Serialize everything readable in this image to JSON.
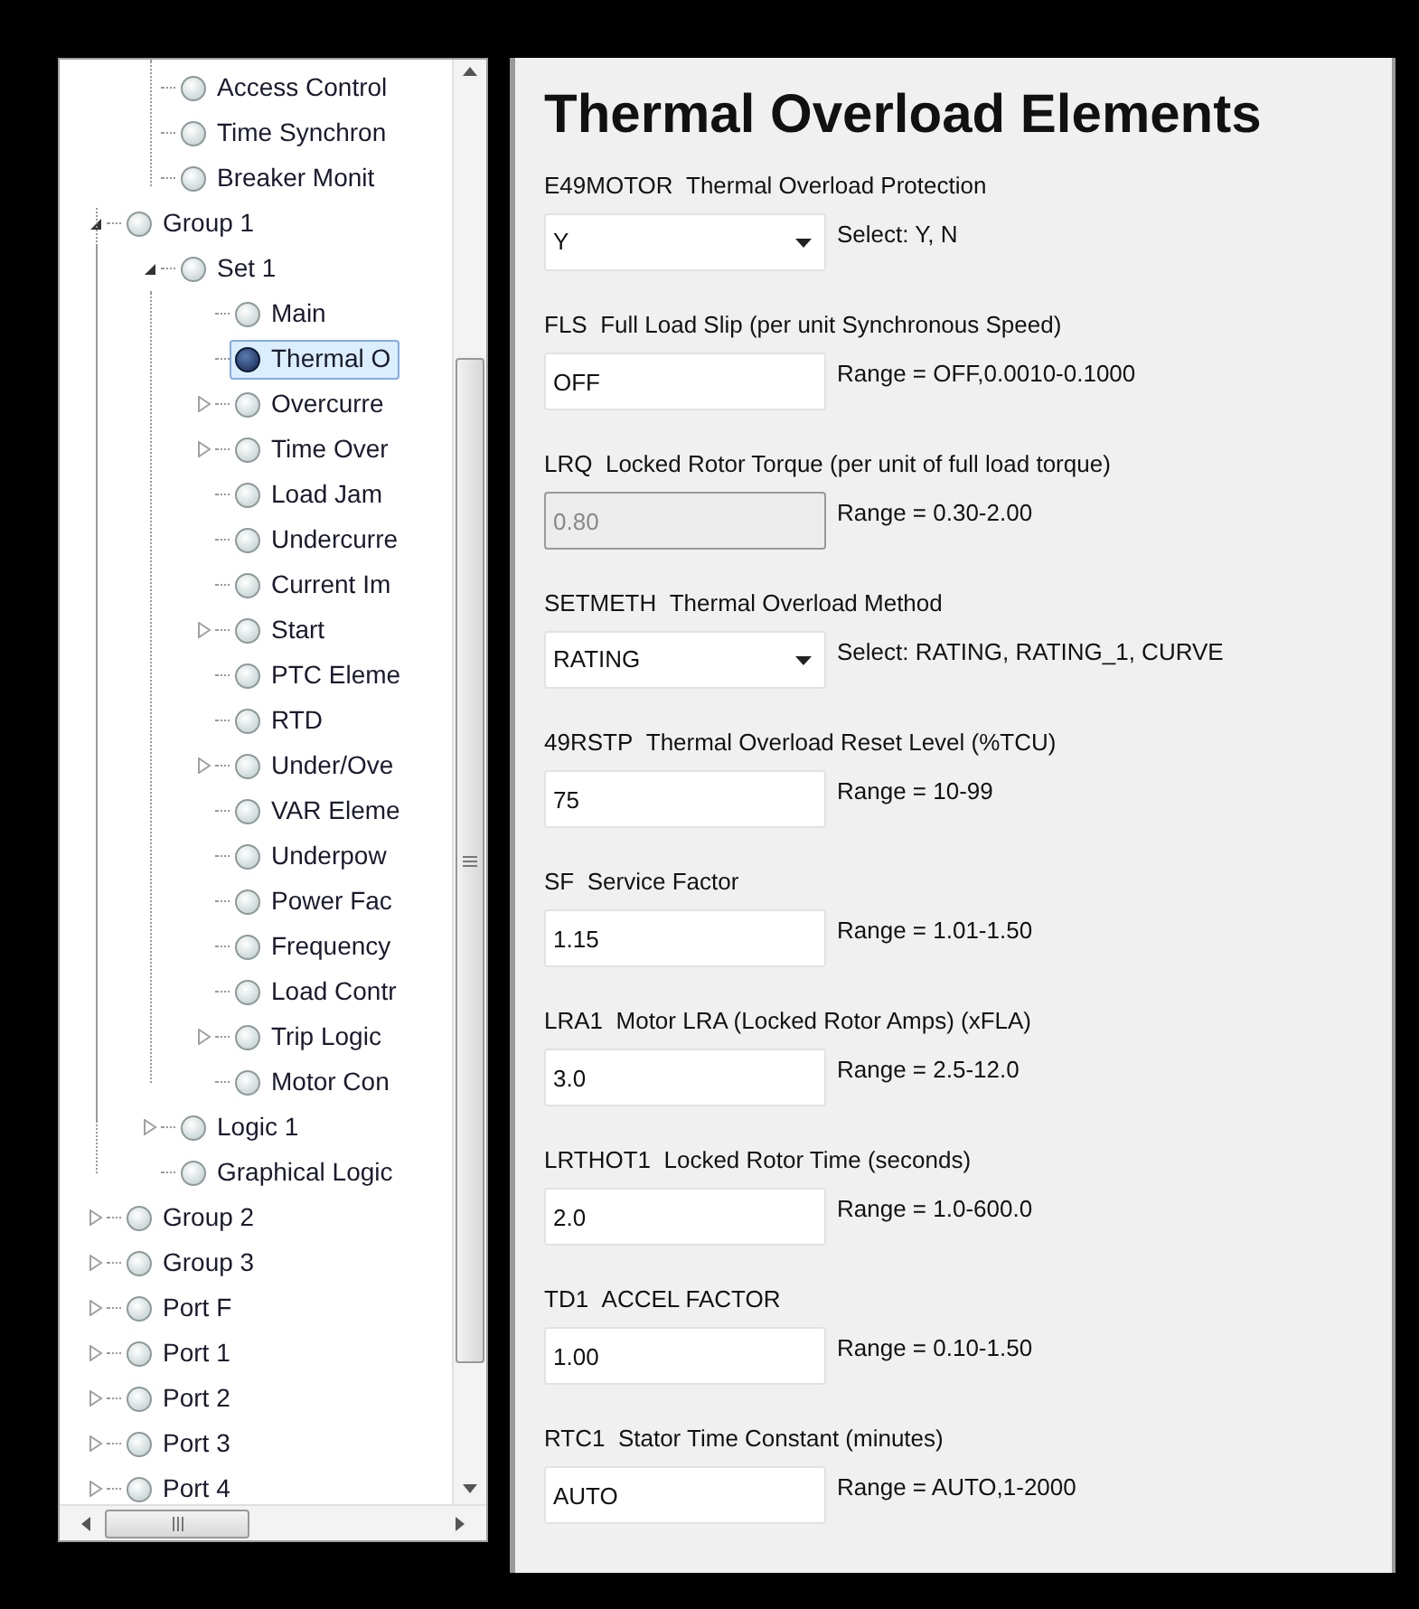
{
  "tree": {
    "continued": [
      {
        "label": "Access Control",
        "selected": false
      },
      {
        "label": "Time Synchron",
        "selected": false
      },
      {
        "label": "Breaker Monit",
        "selected": false
      }
    ],
    "nodes": [
      {
        "label": "Group 1",
        "selected": false,
        "expanded": true,
        "children": [
          {
            "label": "Set 1",
            "selected": false,
            "expanded": true,
            "children": [
              {
                "label": "Main",
                "selected": false
              },
              {
                "label": "Thermal O",
                "selected": true
              },
              {
                "label": "Overcurre",
                "selected": false,
                "expanded": false
              },
              {
                "label": "Time Over",
                "selected": false,
                "expanded": false
              },
              {
                "label": "Load Jam",
                "selected": false
              },
              {
                "label": "Undercurre",
                "selected": false
              },
              {
                "label": "Current Im",
                "selected": false
              },
              {
                "label": "Start",
                "selected": false,
                "expanded": false
              },
              {
                "label": "PTC Eleme",
                "selected": false
              },
              {
                "label": "RTD",
                "selected": false
              },
              {
                "label": "Under/Ove",
                "selected": false,
                "expanded": false
              },
              {
                "label": "VAR Eleme",
                "selected": false
              },
              {
                "label": "Underpow",
                "selected": false
              },
              {
                "label": "Power Fac",
                "selected": false
              },
              {
                "label": "Frequency",
                "selected": false
              },
              {
                "label": "Load Contr",
                "selected": false
              },
              {
                "label": "Trip Logic",
                "selected": false,
                "expanded": false
              },
              {
                "label": "Motor Con",
                "selected": false
              }
            ]
          },
          {
            "label": "Logic 1",
            "selected": false,
            "expanded": false
          },
          {
            "label": "Graphical Logic",
            "selected": false
          }
        ]
      },
      {
        "label": "Group 2",
        "selected": false,
        "expanded": false
      },
      {
        "label": "Group 3",
        "selected": false,
        "expanded": false
      },
      {
        "label": "Port F",
        "selected": false,
        "expanded": false
      },
      {
        "label": "Port 1",
        "selected": false,
        "expanded": false
      },
      {
        "label": "Port 2",
        "selected": false,
        "expanded": false
      },
      {
        "label": "Port 3",
        "selected": false,
        "expanded": false
      },
      {
        "label": "Port 4",
        "selected": false,
        "expanded": false
      }
    ]
  },
  "form": {
    "title": "Thermal Overload Elements",
    "fields": [
      {
        "code": "E49MOTOR",
        "name": "Thermal Overload Protection",
        "kind": "select",
        "value": "Y",
        "disabled": false,
        "hint": "Select: Y, N"
      },
      {
        "code": "FLS",
        "name": "Full Load Slip (per unit Synchronous Speed)",
        "kind": "text",
        "value": "OFF",
        "disabled": false,
        "hint": "Range = OFF,0.0010-0.1000"
      },
      {
        "code": "LRQ",
        "name": "Locked Rotor Torque (per unit of full load torque)",
        "kind": "text",
        "value": "0.80",
        "disabled": true,
        "hint": "Range = 0.30-2.00"
      },
      {
        "code": "SETMETH",
        "name": "Thermal Overload Method",
        "kind": "select",
        "value": "RATING",
        "disabled": false,
        "hint": "Select: RATING, RATING_1, CURVE"
      },
      {
        "code": "49RSTP",
        "name": "Thermal Overload Reset Level (%TCU)",
        "kind": "text",
        "value": "75",
        "disabled": false,
        "hint": "Range = 10-99"
      },
      {
        "code": "SF",
        "name": "Service Factor",
        "kind": "text",
        "value": "1.15",
        "disabled": false,
        "hint": "Range = 1.01-1.50"
      },
      {
        "code": "LRA1",
        "name": "Motor LRA (Locked Rotor Amps) (xFLA)",
        "kind": "text",
        "value": "3.0",
        "disabled": false,
        "hint": "Range = 2.5-12.0"
      },
      {
        "code": "LRTHOT1",
        "name": "Locked Rotor Time (seconds)",
        "kind": "text",
        "value": "2.0",
        "disabled": false,
        "hint": "Range = 1.0-600.0"
      },
      {
        "code": "TD1",
        "name": "ACCEL FACTOR",
        "kind": "text",
        "value": "1.00",
        "disabled": false,
        "hint": "Range = 0.10-1.50"
      },
      {
        "code": "RTC1",
        "name": "Stator Time Constant (minutes)",
        "kind": "text",
        "value": "AUTO",
        "disabled": false,
        "hint": "Range = AUTO,1-2000"
      }
    ]
  }
}
